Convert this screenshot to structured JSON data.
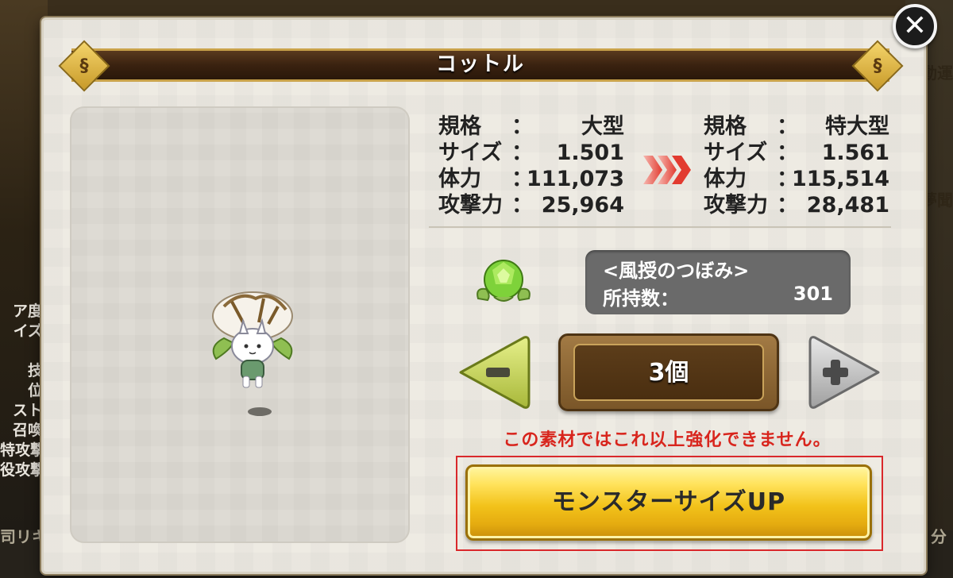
{
  "background": {
    "right_labels": [
      "動運",
      "夢聞"
    ],
    "left_labels": [
      "ア度",
      "イズ",
      "",
      "技",
      "位",
      "スト",
      "召喚",
      "特攻撃",
      "役攻撃"
    ],
    "bottom_left": "司リキ",
    "bottom_right": "分"
  },
  "dialog": {
    "title": "コットル",
    "close_icon": "close-icon"
  },
  "stats_before": {
    "grade_label": "規格",
    "grade_value": "大型",
    "size_label": "サイズ",
    "size_value": "1.501",
    "hp_label": "体力",
    "hp_value": "111,073",
    "atk_label": "攻撃力",
    "atk_value": "25,964",
    "colon": "："
  },
  "stats_after": {
    "grade_label": "規格",
    "grade_value": "特大型",
    "size_label": "サイズ",
    "size_value": "1.561",
    "hp_label": "体力",
    "hp_value": "115,514",
    "atk_label": "攻撃力",
    "atk_value": "28,481",
    "colon": "："
  },
  "material": {
    "icon": "green-bud-icon",
    "name": "<風授のつぼみ>",
    "count_label": "所持数：",
    "count_value": "301"
  },
  "quantity": {
    "value": "3個",
    "decrease_icon": "minus-arrow-icon",
    "increase_icon": "plus-arrow-icon"
  },
  "warning_text": "この素材ではこれ以上強化できません。",
  "action_button": {
    "label": "モンスターサイズUP"
  },
  "colors": {
    "warning": "#d8251d",
    "button_gold": "#f2c21a",
    "banner_brown": "#3a2210"
  }
}
